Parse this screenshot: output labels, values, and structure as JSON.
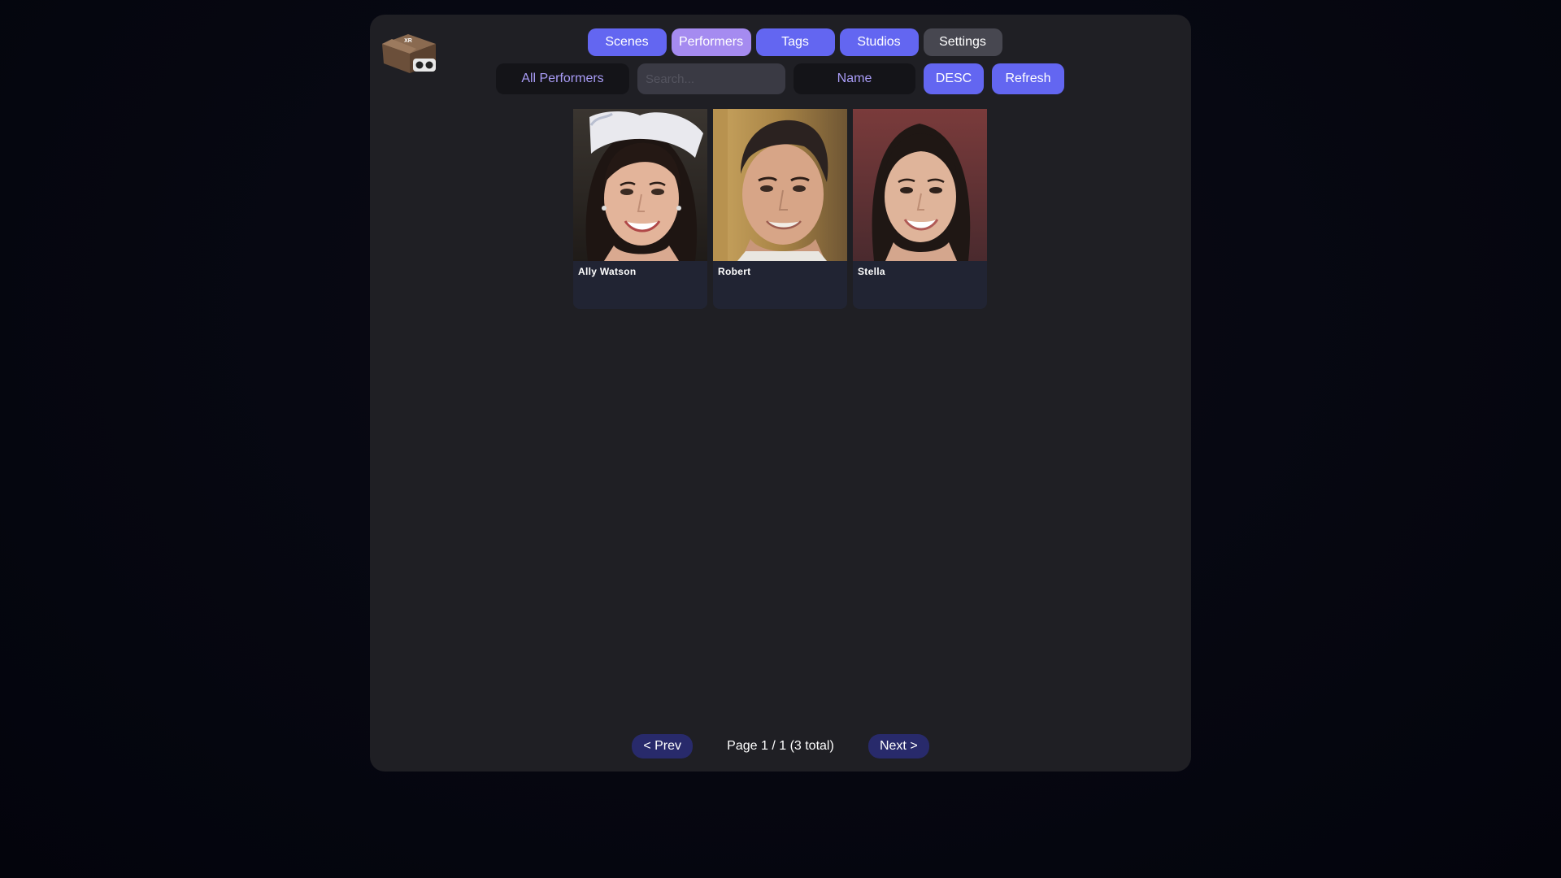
{
  "header": {
    "logo_text": "XR"
  },
  "nav": {
    "items": [
      {
        "label": "Scenes",
        "key": "scenes"
      },
      {
        "label": "Performers",
        "key": "performers"
      },
      {
        "label": "Tags",
        "key": "tags"
      },
      {
        "label": "Studios",
        "key": "studios"
      },
      {
        "label": "Settings",
        "key": "settings"
      }
    ],
    "active": "Performers"
  },
  "toolbar": {
    "filter_label": "All Performers",
    "search_placeholder": "Search...",
    "search_value": "",
    "sort_label": "Name",
    "order_label": "DESC",
    "refresh_label": "Refresh"
  },
  "performers": [
    {
      "name": "Ally Watson",
      "photo": "woman-portrait"
    },
    {
      "name": "Robert",
      "photo": "man-portrait"
    },
    {
      "name": "Stella",
      "photo": "woman-portrait"
    }
  ],
  "pagination": {
    "prev_label": "< Prev",
    "info": "Page 1 / 1 (3 total)",
    "next_label": "Next >"
  },
  "colors": {
    "accent": "#6366f1",
    "active_tab": "#a58bf0",
    "settings_tab": "#474750",
    "panel": "#1f1f24",
    "card": "#212433",
    "pager_button": "#282a6b"
  }
}
